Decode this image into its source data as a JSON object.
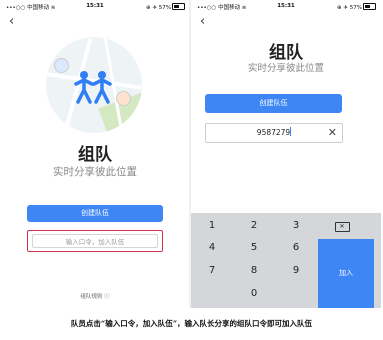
{
  "left": {
    "status": {
      "carrier": "•••○○ 中国移动 ≋",
      "time": "15:31",
      "battery": "57%"
    },
    "title": "组队",
    "subtitle": "实时分享彼此位置",
    "create_button": "创建队伍",
    "input_placeholder": "输入口令，加入队伍",
    "rules": "组队规则 ⓘ"
  },
  "right": {
    "status": {
      "carrier": "•••○○ 中国移动 ≋",
      "time": "15:31",
      "battery": "57%"
    },
    "title": "组队",
    "subtitle": "实时分享彼此位置",
    "create_button": "创建队伍",
    "code_value": "9587279",
    "keys": [
      "1",
      "2",
      "3",
      "4",
      "5",
      "6",
      "7",
      "8",
      "9",
      "0"
    ],
    "join_key": "加入"
  },
  "caption": "队员点击“输入口令，加入队伍”，输入队长分享的组队口令即可加入队伍",
  "colors": {
    "accent": "#3f86f5",
    "highlight": "#d3334a"
  }
}
